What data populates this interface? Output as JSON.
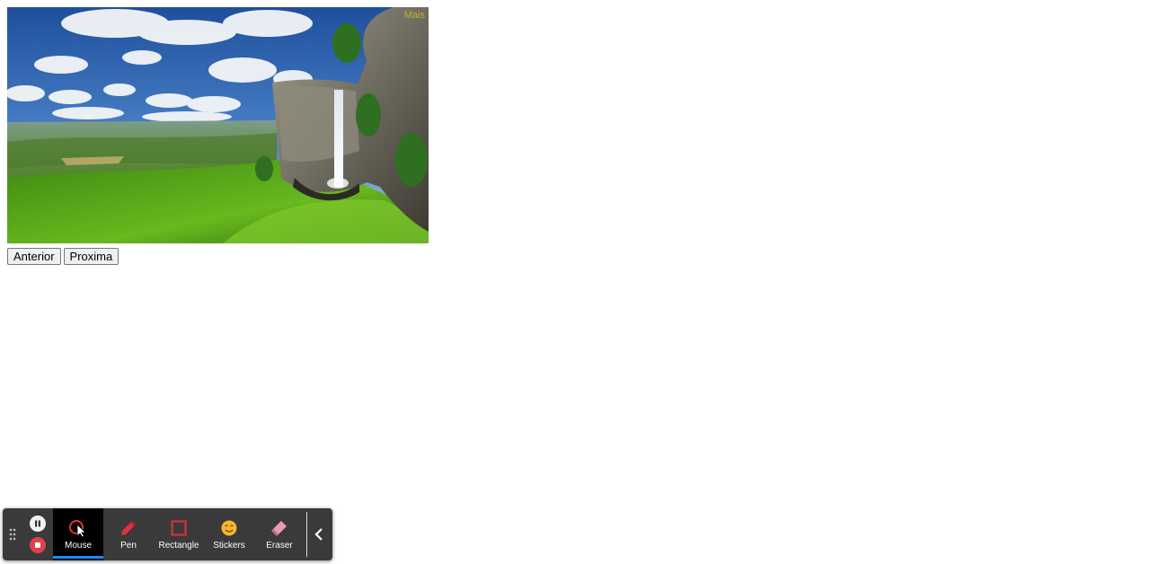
{
  "slideshow": {
    "caption": "Mais",
    "prev_label": "Anterior",
    "next_label": "Proxima"
  },
  "toolbar": {
    "tools": [
      {
        "label": "Mouse",
        "icon": "mouse-cursor-icon",
        "active": true
      },
      {
        "label": "Pen",
        "icon": "pen-icon",
        "active": false
      },
      {
        "label": "Rectangle",
        "icon": "rectangle-icon",
        "active": false
      },
      {
        "label": "Stickers",
        "icon": "sticker-emoji-icon",
        "active": false
      },
      {
        "label": "Eraser",
        "icon": "eraser-icon",
        "active": false
      }
    ],
    "colors": {
      "background": "#3a3a3a",
      "active_tool": "#000000",
      "active_underline": "#1a8cff",
      "stop": "#e0414c",
      "pen": "#e0303a",
      "rectangle": "#e0303a",
      "sticker": "#f5b82e",
      "eraser": "#e89bb8"
    }
  }
}
